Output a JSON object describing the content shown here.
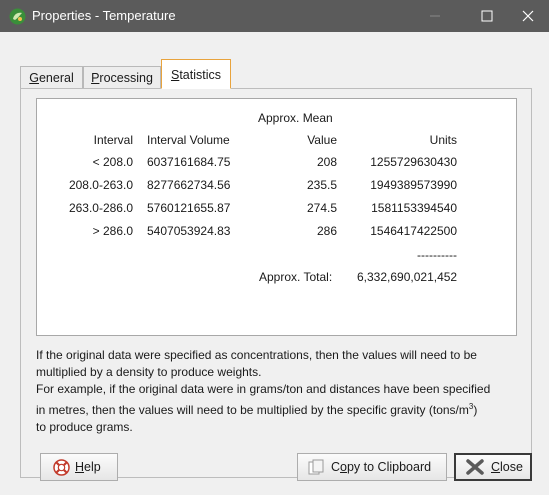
{
  "window": {
    "title": "Properties - Temperature"
  },
  "tabs": [
    {
      "label": "General",
      "mnemonic": "G",
      "rest": "eneral",
      "active": false
    },
    {
      "label": "Processing",
      "mnemonic": "P",
      "rest": "rocessing",
      "active": false
    },
    {
      "label": "Statistics",
      "mnemonic": "S",
      "rest": "tatistics",
      "active": true
    }
  ],
  "table": {
    "header_top": "Approx. Mean",
    "headers": [
      "Interval",
      "Interval Volume",
      "Value",
      "Units"
    ],
    "rows": [
      {
        "interval": "< 208.0",
        "volume": "6037161684.75",
        "value": "208",
        "units": "1255729630430"
      },
      {
        "interval": "208.0-263.0",
        "volume": "8277662734.56",
        "value": "235.5",
        "units": "1949389573990"
      },
      {
        "interval": "263.0-286.0",
        "volume": "5760121655.87",
        "value": "274.5",
        "units": "1581153394540"
      },
      {
        "interval": "> 286.0",
        "volume": "5407053924.83",
        "value": "286",
        "units": "1546417422500"
      }
    ],
    "separator": "----------",
    "total_label": "Approx. Total:",
    "total_value": "6,332,690,021,452"
  },
  "note": {
    "line1": "If the original data were specified as concentrations, then the values will need to be",
    "line2": "multiplied by a density to produce weights.",
    "line3": "For example, if the original data were in grams/ton and distances have been specified",
    "line4": "in metres, then the values will need to be multiplied by the specific gravity (tons/m",
    "line4_sup": "3",
    "line4_end": ")",
    "line5": "to produce grams."
  },
  "buttons": {
    "help": {
      "label": "Help",
      "mnemonic": "H",
      "rest": "elp"
    },
    "copy": {
      "label": "Copy to Clipboard",
      "pre": "C",
      "mnemonic": "o",
      "rest": "py to Clipboard"
    },
    "close": {
      "label": "Close",
      "mnemonic": "C",
      "rest": "lose"
    }
  },
  "colors": {
    "titlebar": "#5b5b5b",
    "active_tab_border": "#e8a33d"
  }
}
